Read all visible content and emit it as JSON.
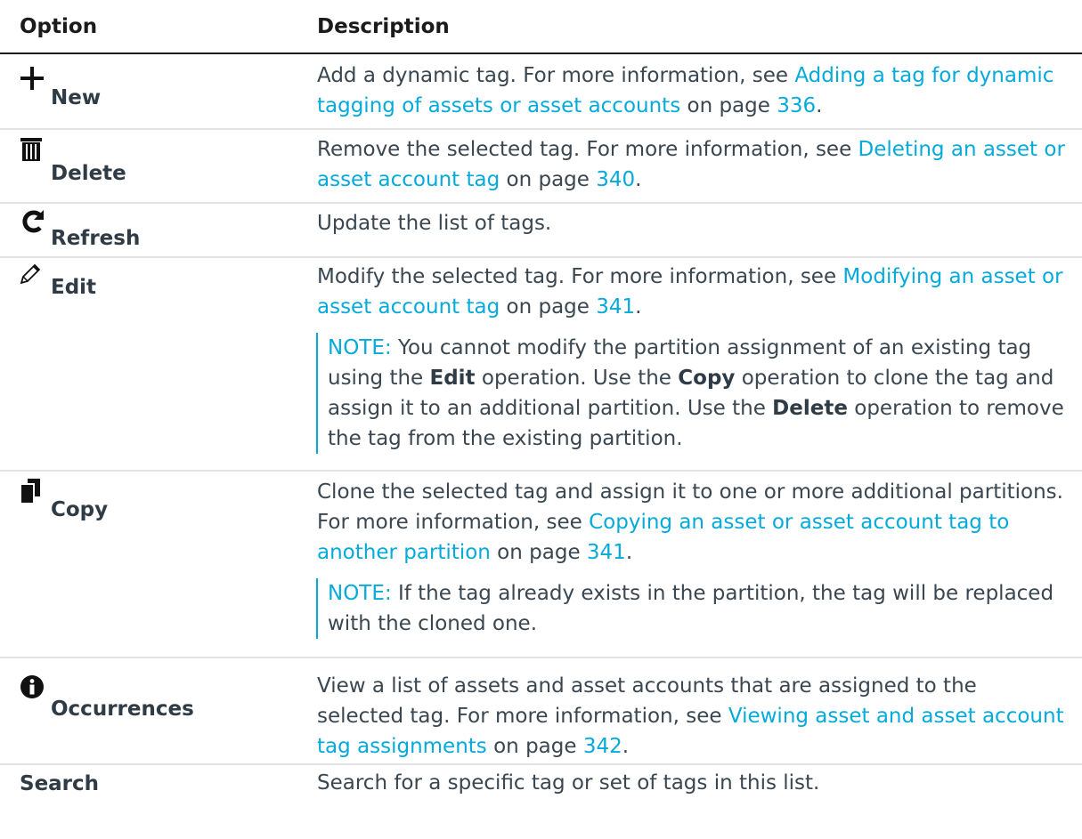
{
  "header": {
    "option": "Option",
    "description": "Description"
  },
  "rows": [
    {
      "label": "New",
      "icon": "plus-icon",
      "desc": {
        "before": "Add a dynamic tag. For more information, see ",
        "link": "Adding a tag for dynamic tagging of assets or asset accounts",
        "mid": " on page ",
        "page": "336",
        "after": "."
      }
    },
    {
      "label": "Delete",
      "icon": "trash-icon",
      "desc": {
        "before": "Remove the selected tag. For more information, see ",
        "link": "Deleting an asset or asset account tag",
        "mid": " on page ",
        "page": "340",
        "after": "."
      }
    },
    {
      "label": "Refresh",
      "icon": "refresh-icon",
      "desc": {
        "text": "Update the list of tags."
      }
    },
    {
      "label": "Edit",
      "icon": "pencil-icon",
      "desc": {
        "before": "Modify the selected tag. For more information, see ",
        "link": "Modifying an asset or asset account tag",
        "mid": " on page ",
        "page": "341",
        "after": "."
      },
      "note": {
        "label": "NOTE:",
        "t1": " You cannot modify the partition assignment of an existing tag using the ",
        "b1": "Edit",
        "t2": " operation. Use the ",
        "b2": "Copy",
        "t3": " operation to clone the tag and assign it to an additional partition. Use the ",
        "b3": "Delete",
        "t4": " operation to remove the tag from the existing partition."
      }
    },
    {
      "label": "Copy",
      "icon": "copy-icon",
      "desc": {
        "before": "Clone the selected tag and assign it to one or more additional partitions. For more information, see ",
        "link": "Copying an asset or asset account tag to another partition",
        "mid": " on page ",
        "page": "341",
        "after": "."
      },
      "note": {
        "label": "NOTE:",
        "text": " If the tag already exists in the partition, the tag will be replaced with the cloned one."
      }
    },
    {
      "label": "Occurrences",
      "icon": "info-icon",
      "desc": {
        "before": "View a list of assets and asset accounts that are assigned to the selected tag. For more information, see ",
        "link": "Viewing asset and asset account tag assignments",
        "mid": " on page ",
        "page": "342",
        "after": "."
      }
    },
    {
      "label": "Search",
      "desc": {
        "text": "Search for a specific tag or set of tags in this list."
      }
    }
  ]
}
